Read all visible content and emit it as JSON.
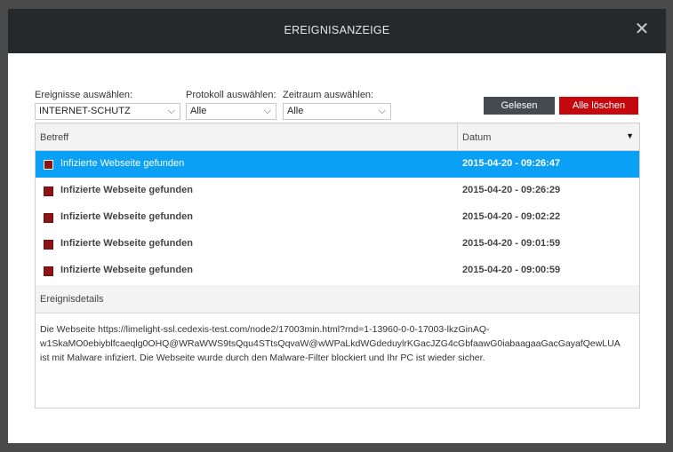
{
  "window": {
    "title": "EREIGNISANZEIGE",
    "close_icon": "close-icon"
  },
  "filters": {
    "events": {
      "label": "Ereignisse auswählen:",
      "value": "INTERNET-SCHUTZ"
    },
    "protocol": {
      "label": "Protokoll auswählen:",
      "value": "Alle"
    },
    "timeframe": {
      "label": "Zeitraum auswählen:",
      "value": "Alle"
    }
  },
  "buttons": {
    "read": "Gelesen",
    "delete_all": "Alle löschen"
  },
  "table": {
    "columns": {
      "subject": "Betreff",
      "date": "Datum"
    },
    "rows": [
      {
        "subject": "Infizierte Webseite gefunden",
        "date": "2015-04-20 - 09:26:47",
        "selected": true
      },
      {
        "subject": "Infizierte Webseite gefunden",
        "date": "2015-04-20 - 09:26:29",
        "selected": false
      },
      {
        "subject": "Infizierte Webseite gefunden",
        "date": "2015-04-20 - 09:02:22",
        "selected": false
      },
      {
        "subject": "Infizierte Webseite gefunden",
        "date": "2015-04-20 - 09:01:59",
        "selected": false
      },
      {
        "subject": "Infizierte Webseite gefunden",
        "date": "2015-04-20 - 09:00:59",
        "selected": false
      }
    ]
  },
  "details": {
    "label": "Ereignisdetails",
    "lines": [
      "Die Webseite https://limelight-ssl.cedexis-test.com/node2/17003min.html?rnd=1-13960-0-0-17003-lkzGinAQ-",
      "w1SkaMO0ebiyblfcaeqlg0OHQ@WRaWWS9tsQqu4STtsQqvaW@wWPaLkdWGdeduylrKGacJZG4cGbfaawG0iabaagaaGacGayafQewLUA",
      "ist mit Malware infiziert. Die Webseite wurde durch den Malware-Filter blockiert und Ihr PC ist wieder sicher."
    ]
  },
  "colors": {
    "titlebar": "#26292c",
    "selected_row": "#0aa0f5",
    "delete_button": "#c5080d",
    "read_button": "#444a50",
    "row_checkbox": "#8c1414"
  }
}
